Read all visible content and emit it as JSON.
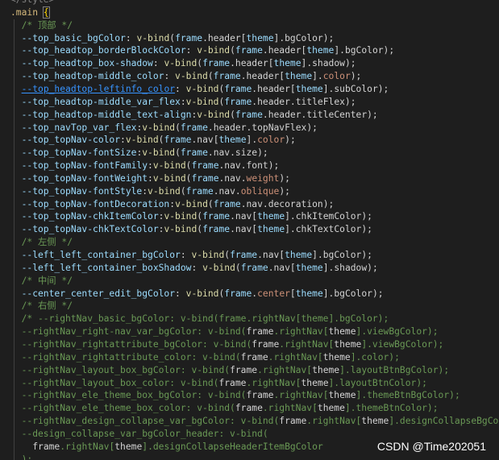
{
  "editor": {
    "language": "vue-css",
    "lines": [
      [
        {
          "t": "</style>",
          "c": "t-plain t-dim"
        }
      ],
      [
        {
          "t": ".main ",
          "c": "t-sel"
        },
        {
          "t": "{",
          "c": "t-brace"
        }
      ],
      [
        {
          "t": "  /* 顶部 */",
          "c": "t-comment"
        }
      ],
      [
        {
          "t": "  --top_basic_bgColor",
          "c": "t-prop"
        },
        {
          "t": ": ",
          "c": "t-plain"
        },
        {
          "t": "v-bind",
          "c": "t-fn"
        },
        {
          "t": "(",
          "c": "t-plain"
        },
        {
          "t": "frame",
          "c": "t-obj"
        },
        {
          "t": ".header[",
          "c": "t-plain"
        },
        {
          "t": "theme",
          "c": "t-obj"
        },
        {
          "t": "].bgColor);",
          "c": "t-plain"
        }
      ],
      [
        {
          "t": "  --top_headtop_borderBlockColor",
          "c": "t-prop"
        },
        {
          "t": ": ",
          "c": "t-plain"
        },
        {
          "t": "v-bind",
          "c": "t-fn"
        },
        {
          "t": "(",
          "c": "t-plain"
        },
        {
          "t": "frame",
          "c": "t-obj"
        },
        {
          "t": ".header[",
          "c": "t-plain"
        },
        {
          "t": "theme",
          "c": "t-obj"
        },
        {
          "t": "].bgColor);",
          "c": "t-plain"
        }
      ],
      [
        {
          "t": "  --top_headtop_box-shadow",
          "c": "t-prop"
        },
        {
          "t": ": ",
          "c": "t-plain"
        },
        {
          "t": "v-bind",
          "c": "t-fn"
        },
        {
          "t": "(",
          "c": "t-plain"
        },
        {
          "t": "frame",
          "c": "t-obj"
        },
        {
          "t": ".header[",
          "c": "t-plain"
        },
        {
          "t": "theme",
          "c": "t-obj"
        },
        {
          "t": "].shadow);",
          "c": "t-plain"
        }
      ],
      [
        {
          "t": "  --top_headtop-middle_color",
          "c": "t-prop"
        },
        {
          "t": ": ",
          "c": "t-plain"
        },
        {
          "t": "v-bind",
          "c": "t-fn"
        },
        {
          "t": "(",
          "c": "t-plain"
        },
        {
          "t": "frame",
          "c": "t-obj"
        },
        {
          "t": ".header[",
          "c": "t-plain"
        },
        {
          "t": "theme",
          "c": "t-obj"
        },
        {
          "t": "].",
          "c": "t-plain"
        },
        {
          "t": "color",
          "c": "t-kw"
        },
        {
          "t": ");",
          "c": "t-plain"
        }
      ],
      [
        {
          "t": "  ",
          "c": "t-plain"
        },
        {
          "t": "--top_headtop-leftinfo_color",
          "c": "t-link"
        },
        {
          "t": ": ",
          "c": "t-plain"
        },
        {
          "t": "v-bind",
          "c": "t-fn"
        },
        {
          "t": "(",
          "c": "t-plain"
        },
        {
          "t": "frame",
          "c": "t-obj"
        },
        {
          "t": ".header[",
          "c": "t-plain"
        },
        {
          "t": "theme",
          "c": "t-obj"
        },
        {
          "t": "].subColor);",
          "c": "t-plain"
        }
      ],
      [
        {
          "t": "  --top_headtop-middle_var_flex",
          "c": "t-prop"
        },
        {
          "t": ":",
          "c": "t-plain"
        },
        {
          "t": "v-bind",
          "c": "t-fn"
        },
        {
          "t": "(",
          "c": "t-plain"
        },
        {
          "t": "frame",
          "c": "t-obj"
        },
        {
          "t": ".header.titleFlex);",
          "c": "t-plain"
        }
      ],
      [
        {
          "t": "  --top_headtop-middle_text-align",
          "c": "t-prop"
        },
        {
          "t": ":",
          "c": "t-plain"
        },
        {
          "t": "v-bind",
          "c": "t-fn"
        },
        {
          "t": "(",
          "c": "t-plain"
        },
        {
          "t": "frame",
          "c": "t-obj"
        },
        {
          "t": ".header.titleCenter);",
          "c": "t-plain"
        }
      ],
      [
        {
          "t": "  --top_navTop_var_flex",
          "c": "t-prop"
        },
        {
          "t": ":",
          "c": "t-plain"
        },
        {
          "t": "v-bind",
          "c": "t-fn"
        },
        {
          "t": "(",
          "c": "t-plain"
        },
        {
          "t": "frame",
          "c": "t-obj"
        },
        {
          "t": ".header.topNavFlex);",
          "c": "t-plain"
        }
      ],
      [
        {
          "t": "  --top_topNav-color",
          "c": "t-prop"
        },
        {
          "t": ":",
          "c": "t-plain"
        },
        {
          "t": "v-bind",
          "c": "t-fn"
        },
        {
          "t": "(",
          "c": "t-plain"
        },
        {
          "t": "frame",
          "c": "t-obj"
        },
        {
          "t": ".nav[",
          "c": "t-plain"
        },
        {
          "t": "theme",
          "c": "t-obj"
        },
        {
          "t": "].",
          "c": "t-plain"
        },
        {
          "t": "color",
          "c": "t-kw"
        },
        {
          "t": ");",
          "c": "t-plain"
        }
      ],
      [
        {
          "t": "  --top_topNav-fontSize",
          "c": "t-prop"
        },
        {
          "t": ":",
          "c": "t-plain"
        },
        {
          "t": "v-bind",
          "c": "t-fn"
        },
        {
          "t": "(",
          "c": "t-plain"
        },
        {
          "t": "frame",
          "c": "t-obj"
        },
        {
          "t": ".nav.size);",
          "c": "t-plain"
        }
      ],
      [
        {
          "t": "  --top_topNav-fontFamily",
          "c": "t-prop"
        },
        {
          "t": ":",
          "c": "t-plain"
        },
        {
          "t": "v-bind",
          "c": "t-fn"
        },
        {
          "t": "(",
          "c": "t-plain"
        },
        {
          "t": "frame",
          "c": "t-obj"
        },
        {
          "t": ".nav.font);",
          "c": "t-plain"
        }
      ],
      [
        {
          "t": "  --top_topNav-fontWeight",
          "c": "t-prop"
        },
        {
          "t": ":",
          "c": "t-plain"
        },
        {
          "t": "v-bind",
          "c": "t-fn"
        },
        {
          "t": "(",
          "c": "t-plain"
        },
        {
          "t": "frame",
          "c": "t-obj"
        },
        {
          "t": ".nav.",
          "c": "t-plain"
        },
        {
          "t": "weight",
          "c": "t-kw"
        },
        {
          "t": ");",
          "c": "t-plain"
        }
      ],
      [
        {
          "t": "  --top_topNav-fontStyle",
          "c": "t-prop"
        },
        {
          "t": ":",
          "c": "t-plain"
        },
        {
          "t": "v-bind",
          "c": "t-fn"
        },
        {
          "t": "(",
          "c": "t-plain"
        },
        {
          "t": "frame",
          "c": "t-obj"
        },
        {
          "t": ".nav.",
          "c": "t-plain"
        },
        {
          "t": "oblique",
          "c": "t-kw"
        },
        {
          "t": ");",
          "c": "t-plain"
        }
      ],
      [
        {
          "t": "  --top_topNav-fontDecoration",
          "c": "t-prop"
        },
        {
          "t": ":",
          "c": "t-plain"
        },
        {
          "t": "v-bind",
          "c": "t-fn"
        },
        {
          "t": "(",
          "c": "t-plain"
        },
        {
          "t": "frame",
          "c": "t-obj"
        },
        {
          "t": ".nav.decoration);",
          "c": "t-plain"
        }
      ],
      [
        {
          "t": "  --top_topNav-chkItemColor",
          "c": "t-prop"
        },
        {
          "t": ":",
          "c": "t-plain"
        },
        {
          "t": "v-bind",
          "c": "t-fn"
        },
        {
          "t": "(",
          "c": "t-plain"
        },
        {
          "t": "frame",
          "c": "t-obj"
        },
        {
          "t": ".nav[",
          "c": "t-plain"
        },
        {
          "t": "theme",
          "c": "t-obj"
        },
        {
          "t": "].chkItemColor);",
          "c": "t-plain"
        }
      ],
      [
        {
          "t": "  --top_topNav-chkTextColor",
          "c": "t-prop"
        },
        {
          "t": ":",
          "c": "t-plain"
        },
        {
          "t": "v-bind",
          "c": "t-fn"
        },
        {
          "t": "(",
          "c": "t-plain"
        },
        {
          "t": "frame",
          "c": "t-obj"
        },
        {
          "t": ".nav[",
          "c": "t-plain"
        },
        {
          "t": "theme",
          "c": "t-obj"
        },
        {
          "t": "].chkTextColor);",
          "c": "t-plain"
        }
      ],
      [
        {
          "t": "  /* 左侧 */",
          "c": "t-comment"
        }
      ],
      [
        {
          "t": "  --left_left_container_bgColor",
          "c": "t-prop"
        },
        {
          "t": ": ",
          "c": "t-plain"
        },
        {
          "t": "v-bind",
          "c": "t-fn"
        },
        {
          "t": "(",
          "c": "t-plain"
        },
        {
          "t": "frame",
          "c": "t-obj"
        },
        {
          "t": ".nav[",
          "c": "t-plain"
        },
        {
          "t": "theme",
          "c": "t-obj"
        },
        {
          "t": "].bgColor);",
          "c": "t-plain"
        }
      ],
      [
        {
          "t": "  --left_left_container_boxShadow",
          "c": "t-prop"
        },
        {
          "t": ": ",
          "c": "t-plain"
        },
        {
          "t": "v-bind",
          "c": "t-fn"
        },
        {
          "t": "(",
          "c": "t-plain"
        },
        {
          "t": "frame",
          "c": "t-obj"
        },
        {
          "t": ".nav[",
          "c": "t-plain"
        },
        {
          "t": "theme",
          "c": "t-obj"
        },
        {
          "t": "].shadow);",
          "c": "t-plain"
        }
      ],
      [
        {
          "t": "  /* 中间 */",
          "c": "t-comment"
        }
      ],
      [
        {
          "t": "  --center_center_edit_bgColor",
          "c": "t-prop"
        },
        {
          "t": ": ",
          "c": "t-plain"
        },
        {
          "t": "v-bind",
          "c": "t-fn"
        },
        {
          "t": "(",
          "c": "t-plain"
        },
        {
          "t": "frame",
          "c": "t-obj"
        },
        {
          "t": ".",
          "c": "t-plain"
        },
        {
          "t": "center",
          "c": "t-kw"
        },
        {
          "t": "[",
          "c": "t-plain"
        },
        {
          "t": "theme",
          "c": "t-obj"
        },
        {
          "t": "].bgColor);",
          "c": "t-plain"
        }
      ],
      [
        {
          "t": "  /* 右侧 */",
          "c": "t-comment"
        }
      ],
      [
        {
          "t": "  /* --rightNav_basic_bgColor: v-bind(frame.rightNav[theme].bgColor);",
          "c": "t-comment"
        }
      ],
      [
        {
          "t": "  --rightNav_right-nav_var_bgColor: ",
          "c": "t-comment"
        },
        {
          "t": "v-bind(",
          "c": "t-comment"
        },
        {
          "t": "frame",
          "c": "t-plain"
        },
        {
          "t": ".rightNav[",
          "c": "t-comment"
        },
        {
          "t": "theme",
          "c": "t-plain"
        },
        {
          "t": "].viewBgColor);",
          "c": "t-comment"
        }
      ],
      [
        {
          "t": "  --rightNav_rightattribute_bgColor: ",
          "c": "t-comment"
        },
        {
          "t": "v-bind(",
          "c": "t-comment"
        },
        {
          "t": "frame",
          "c": "t-plain"
        },
        {
          "t": ".rightNav[",
          "c": "t-comment"
        },
        {
          "t": "theme",
          "c": "t-plain"
        },
        {
          "t": "].viewBgColor);",
          "c": "t-comment"
        }
      ],
      [
        {
          "t": "  --rightNav_rightattribute_color: ",
          "c": "t-comment"
        },
        {
          "t": "v-bind(",
          "c": "t-comment"
        },
        {
          "t": "frame",
          "c": "t-plain"
        },
        {
          "t": ".rightNav[",
          "c": "t-comment"
        },
        {
          "t": "theme",
          "c": "t-plain"
        },
        {
          "t": "].color);",
          "c": "t-comment"
        }
      ],
      [
        {
          "t": "  --rightNav_layout_box_bgColor: ",
          "c": "t-comment"
        },
        {
          "t": "v-bind(",
          "c": "t-comment"
        },
        {
          "t": "frame",
          "c": "t-plain"
        },
        {
          "t": ".rightNav[",
          "c": "t-comment"
        },
        {
          "t": "theme",
          "c": "t-plain"
        },
        {
          "t": "].layoutBtnBgColor);",
          "c": "t-comment"
        }
      ],
      [
        {
          "t": "  --rightNav_layout_box_color: ",
          "c": "t-comment"
        },
        {
          "t": "v-bind(",
          "c": "t-comment"
        },
        {
          "t": "frame",
          "c": "t-plain"
        },
        {
          "t": ".rightNav[",
          "c": "t-comment"
        },
        {
          "t": "theme",
          "c": "t-plain"
        },
        {
          "t": "].layoutBtnColor);",
          "c": "t-comment"
        }
      ],
      [
        {
          "t": "  --rightNav_ele_theme_box_bgColor: ",
          "c": "t-comment"
        },
        {
          "t": "v-bind(",
          "c": "t-comment"
        },
        {
          "t": "frame",
          "c": "t-plain"
        },
        {
          "t": ".rightNav[",
          "c": "t-comment"
        },
        {
          "t": "theme",
          "c": "t-plain"
        },
        {
          "t": "].themeBtnBgColor);",
          "c": "t-comment"
        }
      ],
      [
        {
          "t": "  --rightNav_ele_theme_box_color: ",
          "c": "t-comment"
        },
        {
          "t": "v-bind(",
          "c": "t-comment"
        },
        {
          "t": "frame",
          "c": "t-plain"
        },
        {
          "t": ".rightNav[",
          "c": "t-comment"
        },
        {
          "t": "theme",
          "c": "t-plain"
        },
        {
          "t": "].themeBtnColor);",
          "c": "t-comment"
        }
      ],
      [
        {
          "t": "  --rightNav_design_collapse_var_bgColor: ",
          "c": "t-comment"
        },
        {
          "t": "v-bind(",
          "c": "t-comment"
        },
        {
          "t": "frame",
          "c": "t-plain"
        },
        {
          "t": ".rightNav[",
          "c": "t-comment"
        },
        {
          "t": "theme",
          "c": "t-plain"
        },
        {
          "t": "].designCollapseBgColor);",
          "c": "t-comment"
        }
      ],
      [
        {
          "t": "  --design_collapse_var_bgColor_header: v-bind(",
          "c": "t-comment"
        }
      ],
      [
        {
          "t": "    ",
          "c": "t-comment"
        },
        {
          "t": "frame",
          "c": "t-plain"
        },
        {
          "t": ".rightNav[",
          "c": "t-comment"
        },
        {
          "t": "theme",
          "c": "t-plain"
        },
        {
          "t": "].designCollapseHeaderItemBgColor",
          "c": "t-comment"
        }
      ],
      [
        {
          "t": "  );",
          "c": "t-comment"
        }
      ]
    ]
  },
  "watermark": {
    "text": "CSDN @Time202051"
  }
}
